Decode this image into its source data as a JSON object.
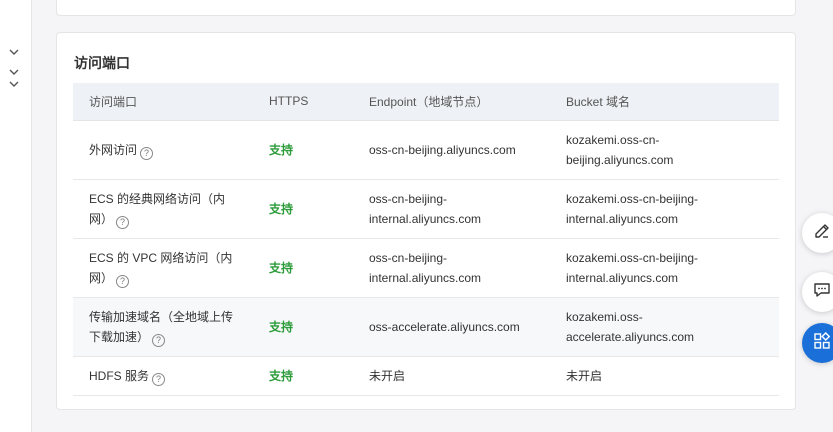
{
  "section": {
    "title": "访问端口"
  },
  "table": {
    "headers": [
      "访问端口",
      "HTTPS",
      "Endpoint（地域节点）",
      "Bucket 域名"
    ],
    "rows": [
      {
        "port_line1": "外网访问",
        "port_line2": "",
        "https": "支持",
        "endpoint_line1": "oss-cn-beijing.aliyuncs.com",
        "endpoint_line2": "",
        "bucket_line1": "kozakemi.oss-cn-",
        "bucket_line2": "beijing.aliyuncs.com"
      },
      {
        "port_line1": "ECS 的经典网络访问（内",
        "port_line2": "网）",
        "https": "支持",
        "endpoint_line1": "oss-cn-beijing-",
        "endpoint_line2": "internal.aliyuncs.com",
        "bucket_line1": "kozakemi.oss-cn-beijing-",
        "bucket_line2": "internal.aliyuncs.com"
      },
      {
        "port_line1": "ECS 的 VPC 网络访问（内",
        "port_line2": "网）",
        "https": "支持",
        "endpoint_line1": "oss-cn-beijing-",
        "endpoint_line2": "internal.aliyuncs.com",
        "bucket_line1": "kozakemi.oss-cn-beijing-",
        "bucket_line2": "internal.aliyuncs.com"
      },
      {
        "port_line1": "传输加速域名（全地域上传",
        "port_line2": "下载加速）",
        "https": "支持",
        "endpoint_line1": "oss-accelerate.aliyuncs.com",
        "endpoint_line2": "",
        "bucket_line1": "kozakemi.oss-",
        "bucket_line2": "accelerate.aliyuncs.com"
      },
      {
        "port_line1": "HDFS 服务",
        "port_line2": "",
        "https": "支持",
        "endpoint_line1": "未开启",
        "endpoint_line2": "",
        "bucket_line1": "未开启",
        "bucket_line2": ""
      }
    ],
    "help_glyph": "?"
  },
  "icons": {
    "left_rail": [
      "chevron-down-icon",
      "chevron-down-icon",
      "chevron-down-icon"
    ],
    "floating": [
      "edit-icon",
      "feedback-icon",
      "apps-icon"
    ]
  },
  "colors": {
    "support_green": "#2c9b3a",
    "header_bg": "#eef1f5",
    "accent_blue": "#1a6fd9"
  }
}
